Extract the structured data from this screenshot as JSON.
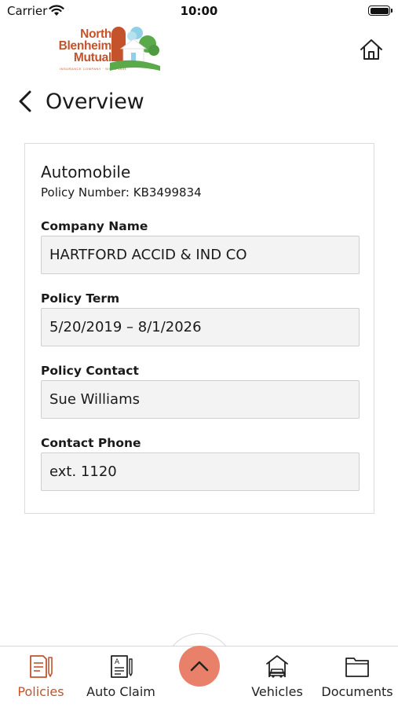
{
  "status_bar": {
    "carrier": "Carrier",
    "time": "10:00",
    "battery_level": 1.0
  },
  "header": {
    "logo": {
      "line1": "North",
      "line2": "Blenheim",
      "line3": "Mutual",
      "tagline": "INSURANCE COMPANY · SINCE 1841",
      "brand_color": "#c4532b"
    },
    "home_icon": "home-icon"
  },
  "nav": {
    "title": "Overview",
    "back_icon": "chevron-left-icon"
  },
  "policy": {
    "type": "Automobile",
    "number_line": "Policy Number: KB3499834",
    "fields": [
      {
        "label": "Company Name",
        "value": "HARTFORD ACCID & IND CO"
      },
      {
        "label": "Policy Term",
        "value": "5/20/2019 – 8/1/2026"
      },
      {
        "label": "Policy Contact",
        "value": "Sue Williams"
      },
      {
        "label": "Contact Phone",
        "value": "ext. 1120"
      }
    ]
  },
  "tab_bar": {
    "active_color": "#c4532b",
    "fab_color": "#e8806a",
    "tabs": [
      {
        "label": "Policies",
        "icon": "policies-document-icon",
        "active": true
      },
      {
        "label": "Auto Claim",
        "icon": "auto-claim-form-icon",
        "active": false
      },
      {
        "label": "Vehicles",
        "icon": "vehicles-car-house-icon",
        "active": false
      },
      {
        "label": "Documents",
        "icon": "documents-folder-icon",
        "active": false
      }
    ],
    "fab_icon": "chevron-up-icon"
  }
}
